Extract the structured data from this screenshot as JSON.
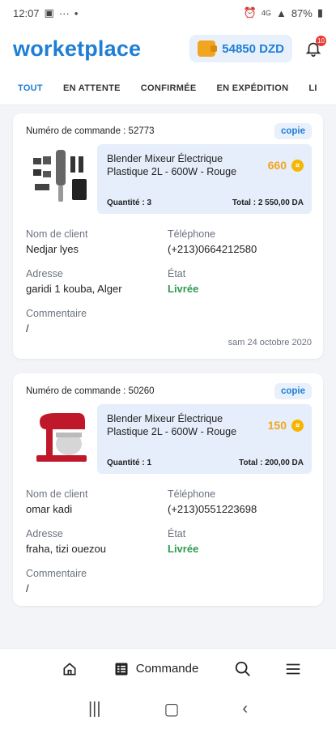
{
  "status_bar": {
    "time": "12:07",
    "battery": "87%",
    "network": "4G"
  },
  "header": {
    "app_title": "worketplace",
    "balance": "54850 DZD",
    "notification_count": "10"
  },
  "tabs": [
    {
      "label": "TOUT",
      "active": true
    },
    {
      "label": "EN ATTENTE",
      "active": false
    },
    {
      "label": "CONFIRMÉE",
      "active": false
    },
    {
      "label": "EN EXPÉDITION",
      "active": false
    },
    {
      "label": "LI",
      "active": false
    }
  ],
  "labels": {
    "copy": "copie",
    "client_name": "Nom de client",
    "phone": "Téléphone",
    "address": "Adresse",
    "state": "État",
    "comment": "Commentaire"
  },
  "orders": [
    {
      "order_number": "Numéro de commande : 52773",
      "product_name": "Blender Mixeur Électrique Plastique 2L - 600W - Rouge",
      "points": "660",
      "quantity": "Quantité : 3",
      "total": "Total : 2 550,00 DA",
      "client": "Nedjar lyes",
      "phone": "(+213)0664212580",
      "address": "garidi 1 kouba, Alger",
      "state": "Livrée",
      "comment": "/",
      "date": "sam 24 octobre 2020"
    },
    {
      "order_number": "Numéro de commande : 50260",
      "product_name": "Blender Mixeur Électrique Plastique 2L - 600W - Rouge",
      "points": "150",
      "quantity": "Quantité : 1",
      "total": "Total : 200,00 DA",
      "client": "omar kadi",
      "phone": "(+213)0551223698",
      "address": "fraha, tizi ouezou",
      "state": "Livrée",
      "comment": "/"
    }
  ],
  "bottom_nav": {
    "active_label": "Commande"
  },
  "colors": {
    "accent": "#1e7ed6",
    "status_delivered": "#2e9b4f",
    "coin": "#f7b500"
  }
}
